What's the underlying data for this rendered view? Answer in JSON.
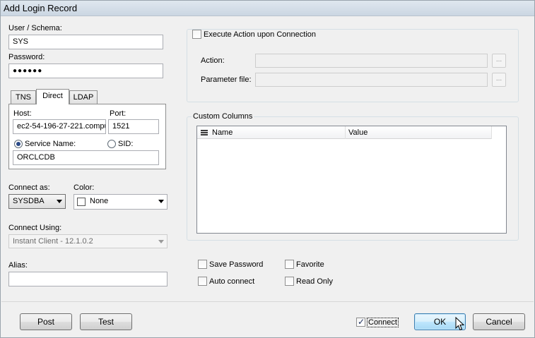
{
  "window": {
    "title": "Add Login Record"
  },
  "user": {
    "label": "User / Schema:",
    "value": "SYS"
  },
  "password": {
    "label": "Password:",
    "value": "●●●●●●"
  },
  "tabs": [
    {
      "label": "TNS",
      "active": false
    },
    {
      "label": "Direct",
      "active": true
    },
    {
      "label": "LDAP",
      "active": false
    }
  ],
  "direct": {
    "host_label": "Host:",
    "host_value": "ec2-54-196-27-221.compu",
    "port_label": "Port:",
    "port_value": "1521",
    "service_name_label": "Service Name:",
    "sid_label": "SID:",
    "service_value": "ORCLCDB"
  },
  "connect_as": {
    "label": "Connect as:",
    "value": "SYSDBA"
  },
  "color": {
    "label": "Color:",
    "value": "None"
  },
  "connect_using": {
    "label": "Connect Using:",
    "value": "Instant Client - 12.1.0.2"
  },
  "alias": {
    "label": "Alias:",
    "value": ""
  },
  "execute_action": {
    "label": "Execute Action upon Connection",
    "action_label": "Action:",
    "parameter_label": "Parameter file:",
    "browse_label": "..."
  },
  "custom_columns": {
    "title": "Custom Columns",
    "columns": [
      "Name",
      "Value"
    ]
  },
  "options": {
    "save_password": "Save Password",
    "favorite": "Favorite",
    "auto_connect": "Auto connect",
    "read_only": "Read Only"
  },
  "buttons": {
    "post": "Post",
    "test": "Test",
    "connect": "Connect",
    "ok": "OK",
    "cancel": "Cancel"
  }
}
